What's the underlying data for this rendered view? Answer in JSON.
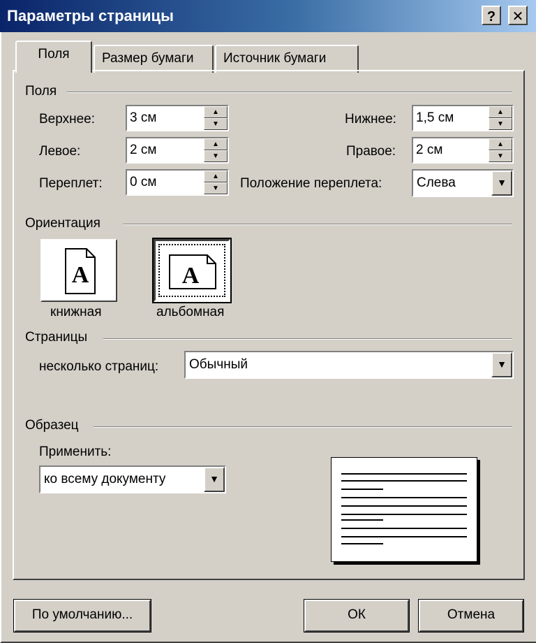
{
  "window": {
    "title": "Параметры страницы",
    "help_label": "?",
    "close_label": "✕"
  },
  "tabs": [
    {
      "label": "Поля",
      "active": true
    },
    {
      "label": "Размер бумаги",
      "active": false
    },
    {
      "label": "Источник бумаги",
      "active": false
    }
  ],
  "margins": {
    "group_title": "Поля",
    "top": {
      "label": "Верхнее:",
      "value": "3 см"
    },
    "bottom": {
      "label": "Нижнее:",
      "value": "1,5 см"
    },
    "left": {
      "label": "Левое:",
      "value": "2 см"
    },
    "right": {
      "label": "Правое:",
      "value": "2 см"
    },
    "gutter": {
      "label": "Переплет:",
      "value": "0 см"
    },
    "gutter_position": {
      "label": "Положение переплета:",
      "value": "Слева"
    }
  },
  "orientation": {
    "group_title": "Ориентация",
    "portrait_label": "книжная",
    "landscape_label": "альбомная",
    "icon_letter": "A",
    "selected": "landscape"
  },
  "pages": {
    "group_title": "Страницы",
    "multiple_label": "несколько страниц:",
    "multiple_value": "Обычный"
  },
  "preview": {
    "group_title": "Образец",
    "apply_label": "Применить:",
    "apply_value": "ко всему документу"
  },
  "buttons": {
    "default_label": "По умолчанию...",
    "ok_label": "ОК",
    "cancel_label": "Отмена"
  },
  "colors": {
    "dialog_bg": "#d4d0c8",
    "titlebar_start": "#0a246a",
    "titlebar_end": "#a6caf0"
  }
}
